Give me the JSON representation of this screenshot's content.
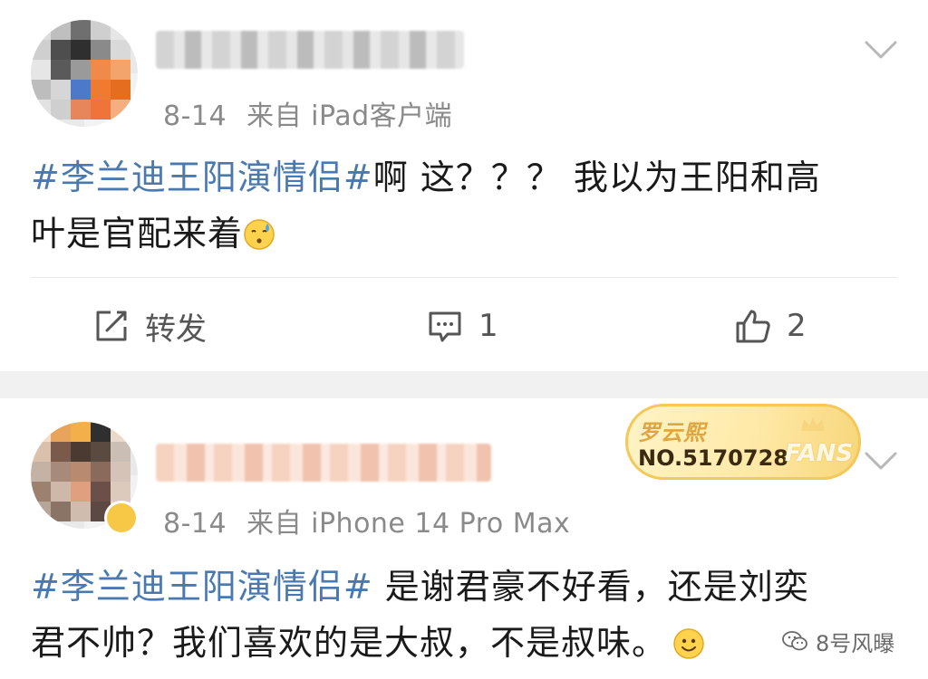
{
  "posts": [
    {
      "date": "8-14",
      "source": "来自 iPad客户端",
      "hashtag": "#李兰迪王阳演情侣#",
      "text_line1": "啊 这？？？ 我以为王阳和高",
      "text_line2": "叶是官配来着",
      "emoji_icon": "sweat-smile-emoji-icon",
      "actions": {
        "repost_label": "转发",
        "comment_count": "1",
        "like_count": "2"
      }
    },
    {
      "date": "8-14",
      "source": "来自 iPhone 14 Pro Max",
      "hashtag": "#李兰迪王阳演情侣#",
      "text_line1": " 是谢君豪不好看，还是刘奕",
      "text_line2": "君不帅？我们喜欢的是大叔，不是叔味。",
      "emoji_icon": "smile-emoji-icon",
      "fans_badge": {
        "name": "罗云熙",
        "number": "NO.5170728",
        "label": "FANS"
      }
    }
  ],
  "watermark": {
    "text": "8号风曝",
    "icon": "wechat-icon"
  },
  "colors": {
    "hashtag": "#4a79b0",
    "meta": "#8a8a8a",
    "separator": "#f1f1f1",
    "badge_gold": "#f4c95a"
  }
}
